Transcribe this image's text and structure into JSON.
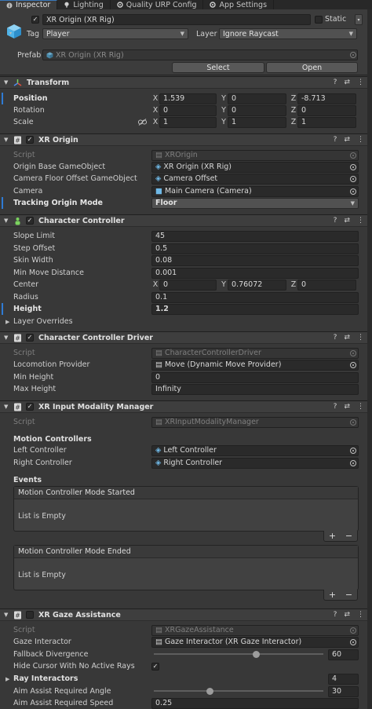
{
  "tabs": [
    {
      "label": "Inspector",
      "icon": "info-icon",
      "active": true
    },
    {
      "label": "Lighting",
      "icon": "lightbulb-icon",
      "active": false
    },
    {
      "label": "Quality URP Config",
      "icon": "settings-icon",
      "active": false
    },
    {
      "label": "App Settings",
      "icon": "settings-icon",
      "active": false
    }
  ],
  "gameobject": {
    "name": "XR Origin (XR Rig)",
    "static_label": "Static",
    "tag_label": "Tag",
    "tag_value": "Player",
    "layer_label": "Layer",
    "layer_value": "Ignore Raycast",
    "prefab_label": "Prefab",
    "prefab_value": "XR Origin (XR Rig)",
    "select_label": "Select",
    "open_label": "Open"
  },
  "transform": {
    "title": "Transform",
    "position": {
      "label": "Position",
      "x": "1.539",
      "y": "0",
      "z": "-8.713"
    },
    "rotation": {
      "label": "Rotation",
      "x": "0",
      "y": "0",
      "z": "0"
    },
    "scale": {
      "label": "Scale",
      "x": "1",
      "y": "1",
      "z": "1"
    },
    "axis": {
      "x": "X",
      "y": "Y",
      "z": "Z"
    }
  },
  "xr_origin": {
    "title": "XR Origin",
    "script_label": "Script",
    "script_value": "XROrigin",
    "origin_base_label": "Origin Base GameObject",
    "origin_base_value": "XR Origin (XR Rig)",
    "camera_floor_label": "Camera Floor Offset GameObject",
    "camera_floor_value": "Camera Offset",
    "camera_label": "Camera",
    "camera_value": "Main Camera (Camera)",
    "tracking_label": "Tracking Origin Mode",
    "tracking_value": "Floor"
  },
  "character_controller": {
    "title": "Character Controller",
    "slope_label": "Slope Limit",
    "slope_value": "45",
    "step_label": "Step Offset",
    "step_value": "0.5",
    "skin_label": "Skin Width",
    "skin_value": "0.08",
    "minmove_label": "Min Move Distance",
    "minmove_value": "0.001",
    "center_label": "Center",
    "center_x": "0",
    "center_y": "0.76072",
    "center_z": "0",
    "radius_label": "Radius",
    "radius_value": "0.1",
    "height_label": "Height",
    "height_value": "1.2",
    "layer_overrides_label": "Layer Overrides"
  },
  "cc_driver": {
    "title": "Character Controller Driver",
    "script_label": "Script",
    "script_value": "CharacterControllerDriver",
    "locomotion_label": "Locomotion Provider",
    "locomotion_value": "Move (Dynamic Move Provider)",
    "minheight_label": "Min Height",
    "minheight_value": "0",
    "maxheight_label": "Max Height",
    "maxheight_value": "Infinity"
  },
  "input_modality": {
    "title": "XR Input Modality Manager",
    "script_label": "Script",
    "script_value": "XRInputModalityManager",
    "motion_controllers_label": "Motion Controllers",
    "left_label": "Left Controller",
    "left_value": "Left Controller",
    "right_label": "Right Controller",
    "right_value": "Right Controller",
    "events_label": "Events",
    "mode_started_label": "Motion Controller Mode Started",
    "mode_ended_label": "Motion Controller Mode Ended",
    "list_empty": "List is Empty",
    "plus": "+",
    "minus": "−"
  },
  "gaze_assistance": {
    "title": "XR Gaze Assistance",
    "script_label": "Script",
    "script_value": "XRGazeAssistance",
    "gaze_interactor_label": "Gaze Interactor",
    "gaze_interactor_value": "Gaze Interactor (XR Gaze Interactor)",
    "fallback_label": "Fallback Divergence",
    "fallback_value": "60",
    "fallback_fraction": 0.6,
    "hide_cursor_label": "Hide Cursor With No Active Rays",
    "ray_interactors_label": "Ray Interactors",
    "ray_interactors_value": "4",
    "aim_angle_label": "Aim Assist Required Angle",
    "aim_angle_value": "30",
    "aim_angle_fraction": 0.33,
    "aim_speed_label": "Aim Assist Required Speed",
    "aim_speed_value": "0.25"
  }
}
